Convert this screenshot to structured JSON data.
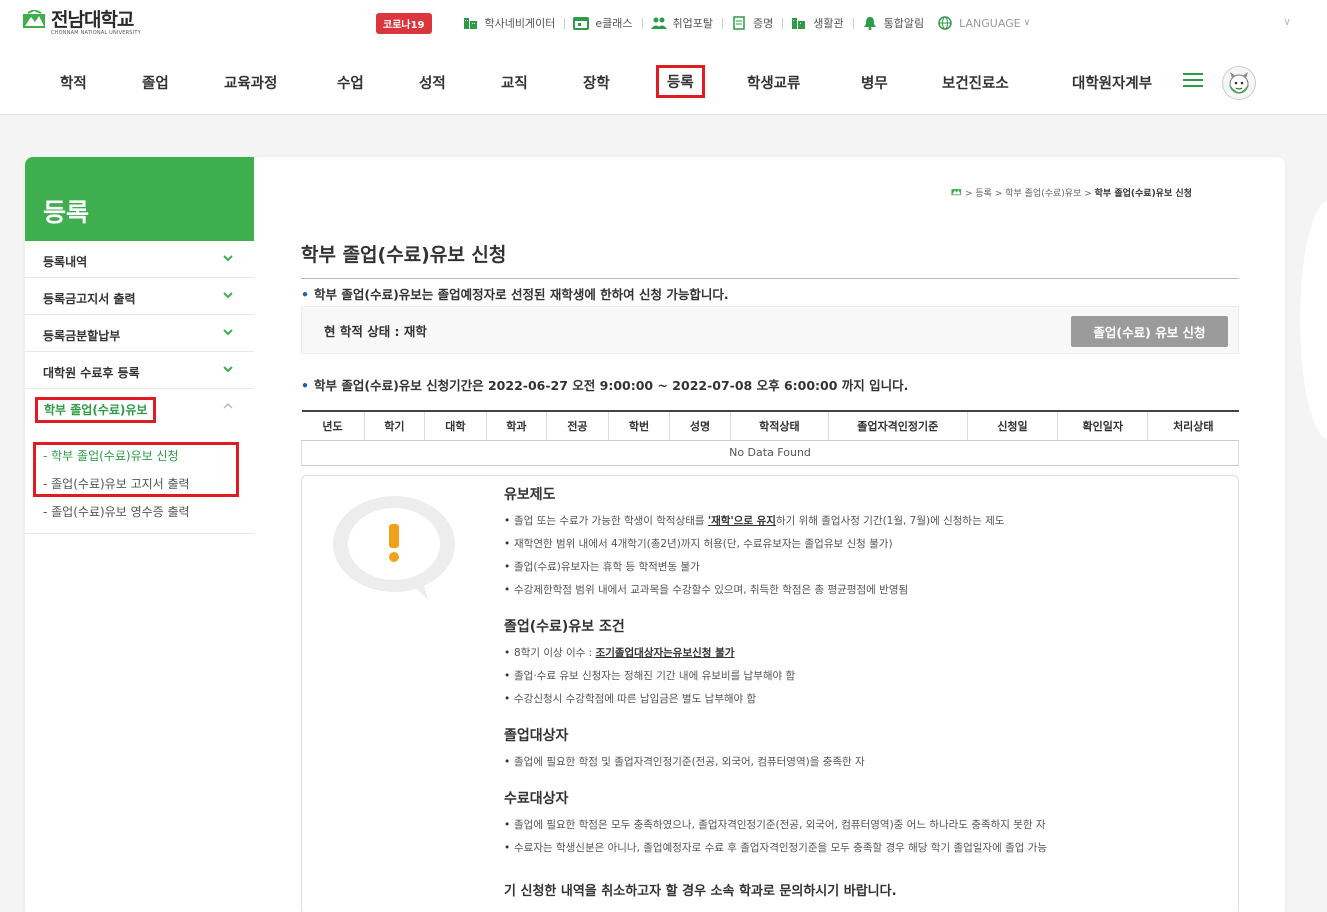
{
  "header": {
    "logo_name": "전남대학교",
    "logo_sub": "CHONNAM NATIONAL UNIVERSITY",
    "covid_badge": "코로나19",
    "util_links": [
      {
        "label": "학사네비게이터",
        "icon": "building-icon"
      },
      {
        "label": "e클래스",
        "icon": "calendar-icon"
      },
      {
        "label": "취업포탈",
        "icon": "people-icon"
      },
      {
        "label": "증명",
        "icon": "document-icon"
      },
      {
        "label": "생활관",
        "icon": "dormitory-icon"
      },
      {
        "label": "통합알림",
        "icon": "bell-icon"
      }
    ],
    "language": "LANGUAGE"
  },
  "gnb": [
    "학적",
    "졸업",
    "교육과정",
    "수업",
    "성적",
    "교직",
    "장학",
    "등록",
    "학생교류",
    "병무",
    "보건진료소",
    "대학원자계부"
  ],
  "gnb_active": "등록",
  "sidebar": {
    "title": "등록",
    "items": [
      {
        "label": "등록내역"
      },
      {
        "label": "등록금고지서 출력"
      },
      {
        "label": "등록금분할납부"
      },
      {
        "label": "대학원 수료후 등록"
      },
      {
        "label": "학부 졸업(수료)유보"
      }
    ],
    "sub_items": [
      {
        "label": "- 학부 졸업(수료)유보 신청"
      },
      {
        "label": "- 졸업(수료)유보 고지서 출력"
      },
      {
        "label": "- 졸업(수료)유보 영수증 출력"
      }
    ]
  },
  "breadcrumb": {
    "path": "> 등록 > 학부 졸업(수료)유보 >",
    "current": "학부 졸업(수료)유보 신청"
  },
  "page": {
    "title": "학부 졸업(수료)유보 신청",
    "notice": "학부 졸업(수료)유보는 졸업예정자로 선정된 재학생에 한하여 신청 가능합니다.",
    "status_text": "현 학적 상태 : 재학",
    "apply_button": "졸업(수료) 유보 신청",
    "period": "학부 졸업(수료)유보 신청기간은 2022-06-27 오전 9:00:00 ~ 2022-07-08 오후 6:00:00 까지 입니다."
  },
  "table": {
    "headers": [
      "년도",
      "학기",
      "대학",
      "학과",
      "전공",
      "학번",
      "성명",
      "학적상태",
      "졸업자격인정기준",
      "신청일",
      "확인일자",
      "처리상태"
    ],
    "empty": "No Data Found"
  },
  "info": {
    "s1_title": "유보제도",
    "s1_b1_pre": "졸업 또는 수료가 가능한 학생이 학적상태를 ",
    "s1_b1_u": "'재학'으로 유지",
    "s1_b1_post": "하기 위해 졸업사정 기간(1월, 7월)에 신청하는 제도",
    "s1_b2": "재학연한 범위 내에서 4개학기(총2년)까지 허용(단, 수료유보자는 졸업유보 신청 불가)",
    "s1_b3": "졸업(수료)유보자는 휴학 등 학적변동 불가",
    "s1_b4": "수강제한학점 범위 내에서 교과목을 수강할수 있으며, 취득한 학점은 총 평균평점에 반영됨",
    "s2_title": "졸업(수료)유보 조건",
    "s2_b1_pre": "8학기 이상 이수 : ",
    "s2_b1_u": "조기졸업대상자는유보신청 불가",
    "s2_b2": "졸업·수료 유보 신청자는 정해진 기간 내에 유보비를 납부해야 함",
    "s2_b3": "수강신청시 수강학점에 따른 납입금은 별도 납부해야 함",
    "s3_title": "졸업대상자",
    "s3_b1": "졸업에 필요한 학점 및 졸업자격인정기준(전공, 외국어, 컴퓨터영역)을 충족한 자",
    "s4_title": "수료대상자",
    "s4_b1": "졸업에 필요한 학점은 모두 충족하였으나, 졸업자격인정기준(전공, 외국어, 컴퓨터영역)중 어느 하나라도 충족하지 못한 자",
    "s4_b2": "수료자는 학생신분은 아니나, 졸업예정자로 수료 후 졸업자격인정기준을 모두 충족할 경우 해당 학기 졸업일자에 졸업 가능",
    "closing": "기 신청한 내역을 취소하고자 할 경우 소속 학과로 문의하시기 바랍니다."
  },
  "colors": {
    "accent": "#3fae4f",
    "highlight": "#e01b24",
    "button": "#9b9b9b"
  }
}
